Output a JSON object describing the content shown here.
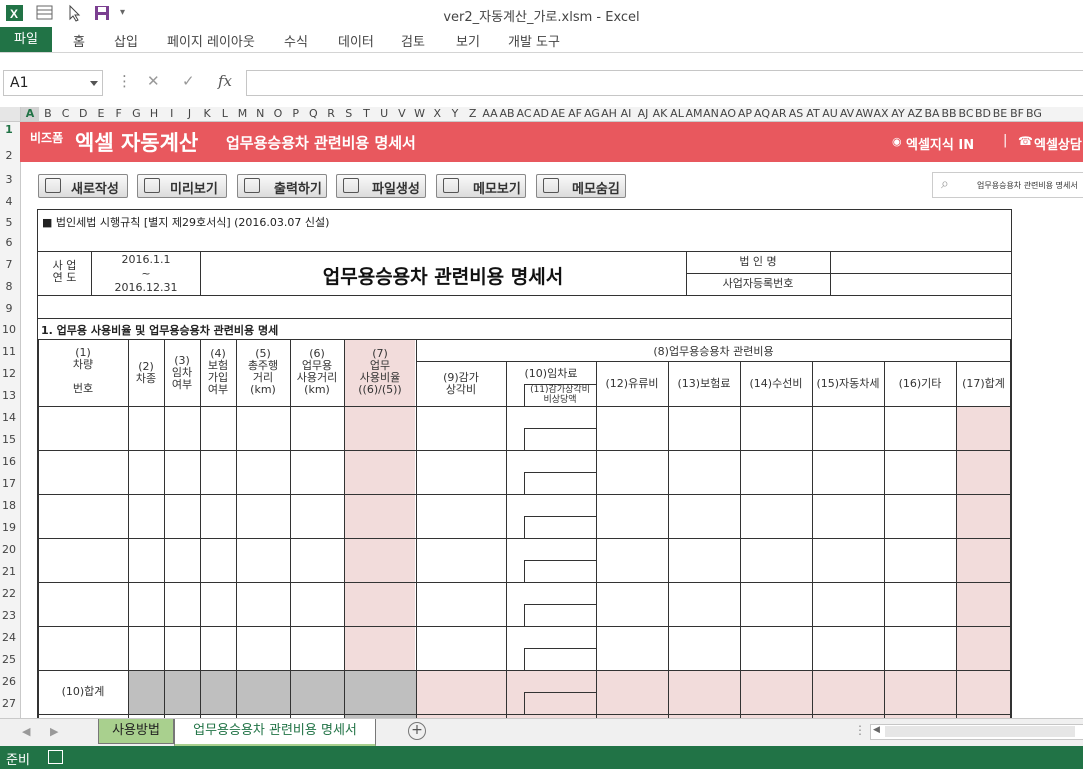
{
  "window": {
    "title": "ver2_자동계산_가로.xlsm - Excel"
  },
  "ribbon": {
    "tabs": [
      "파일",
      "홈",
      "삽입",
      "페이지 레이아웃",
      "수식",
      "데이터",
      "검토",
      "보기",
      "개발 도구"
    ]
  },
  "formula_bar": {
    "name_box": "A1",
    "fx": "fx",
    "value": ""
  },
  "columns": [
    "A",
    "B",
    "C",
    "D",
    "E",
    "F",
    "G",
    "H",
    "I",
    "J",
    "K",
    "L",
    "M",
    "N",
    "O",
    "P",
    "Q",
    "R",
    "S",
    "T",
    "U",
    "V",
    "W",
    "X",
    "Y",
    "Z",
    "AA",
    "AB",
    "AC",
    "AD",
    "AE",
    "AF",
    "AG",
    "AH",
    "AI",
    "AJ",
    "AK",
    "AL",
    "AM",
    "AN",
    "AO",
    "AP",
    "AQ",
    "AR",
    "AS",
    "AT",
    "AU",
    "AV",
    "AW",
    "AX",
    "AY",
    "AZ",
    "BA",
    "BB",
    "BC",
    "BD",
    "BE",
    "BF",
    "BG"
  ],
  "rows": [
    "1",
    "2",
    "3",
    "4",
    "5",
    "6",
    "7",
    "8",
    "9",
    "10",
    "11",
    "12",
    "13",
    "14",
    "15",
    "16",
    "17",
    "18",
    "19",
    "20",
    "21",
    "22",
    "23",
    "24",
    "25",
    "26",
    "27"
  ],
  "banner": {
    "brand_small": "비즈폼",
    "brand_large": "엑셀 자동계산",
    "doc_title": "업무용승용차 관련비용 명세서",
    "link1": "엑셀지식 IN",
    "link2": "엑셀상담"
  },
  "toolbar": {
    "buttons": [
      "새로작성",
      "미리보기",
      "출력하기",
      "파일생성",
      "메모보기",
      "메모숨김"
    ],
    "search_value": "업무용승용차 관련비용 명세서"
  },
  "form": {
    "law_ref": "■ 법인세법 시행규칙 [별지 제29호서식] (2016.03.07 신설)",
    "year_label": "사 업\n연 도",
    "period_start": "2016.1.1",
    "period_sep": "~",
    "period_end": "2016.12.31",
    "main_title": "업무용승용차 관련비용 명세서",
    "corp_name_label": "법 인 명",
    "biz_reg_label": "사업자등록번호",
    "section1": "1. 업무용 사용비율 및 업무용승용차 관련비용 명세",
    "headers": {
      "c1": "(1)\n차량\n\n번호",
      "c2": "(2)\n차종",
      "c3": "(3)\n임차\n여부",
      "c4": "(4)\n보험\n가입\n여부",
      "c5": "(5)\n총주행\n거리\n(km)",
      "c6": "(6)\n업무용\n사용거리\n(km)",
      "c7": "(7)\n업무\n사용비율\n((6)/(5))",
      "c8": "(8)업무용승용차 관련비용",
      "c9": "(9)감가\n상각비",
      "c10": "(10)임차료",
      "c11": "(11)감가상각비\n비상당액",
      "c12": "(12)유류비",
      "c13": "(13)보험료",
      "c14": "(14)수선비",
      "c15": "(15)자동차세",
      "c16": "(16)기타",
      "c17": "(17)합계"
    },
    "total_label": "(10)합계"
  },
  "sheet_tabs": {
    "tab1": "사용방법",
    "tab2": "업무용승용차 관련비용 명세서"
  },
  "status": {
    "ready": "준비"
  }
}
